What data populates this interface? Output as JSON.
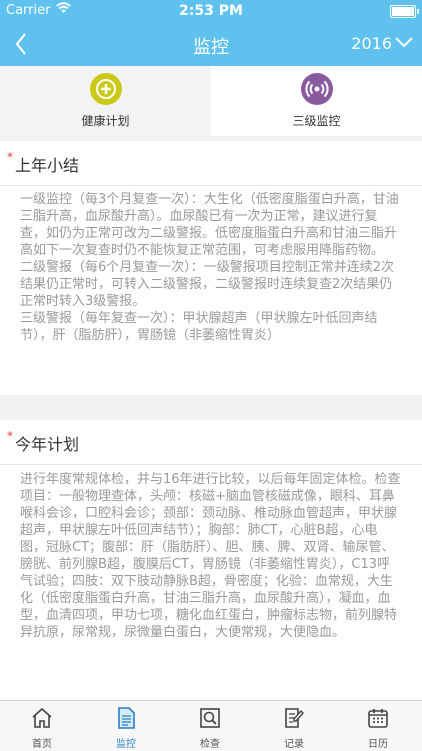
{
  "status": {
    "carrier": "Carrier",
    "time": "2:53 PM",
    "battery_level": 0.9
  },
  "nav": {
    "title": "监控",
    "year": "2016"
  },
  "tabs": [
    {
      "label": "健康计划",
      "color": "#cbc918"
    },
    {
      "label": "三级监控",
      "color": "#8a5a9f"
    }
  ],
  "sections": {
    "last_year": {
      "title": "上年小结",
      "paragraphs": [
        "一级监控（每3个月复查一次）：大生化（低密度脂蛋白升高，甘油三脂升高，血尿酸升高）。血尿酸已有一次为正常，建议进行复查，如仍为正常可改为二级警报。低密度脂蛋白升高和甘油三脂升高如下一次复查时仍不能恢复正常范围，可考虑服用降脂药物。",
        "二级警报（每6个月复查一次）：一级警报项目控制正常并连续2次结果仍正常时，可转入二级警报，二级警报时连续复查2次结果仍正常时转入3级警报。",
        "三级警报（每年复查一次）：甲状腺超声（甲状腺左叶低回声结节），肝（脂肪肝），胃肠镜（非萎缩性胃炎）"
      ]
    },
    "this_year": {
      "title": "今年计划",
      "paragraphs": [
        "进行年度常规体检，并与16年进行比较，以后每年固定体检。检查项目：一般物理查体，头颅：核磁+脑血管核磁成像，眼科、耳鼻喉科会诊，口腔科会诊；颈部：颈动脉、椎动脉血管超声，甲状腺超声，甲状腺左叶低回声结节）；胸部：肺CT，心脏B超，心电图，冠脉CT；腹部：肝（脂肪肝）、胆、胰、脾、双肾、输尿管、膀胱、前列腺B超，腹膜后CT，胃肠镜（非萎缩性胃炎），C13呼气试验；四肢：双下肢动静脉B超，骨密度；化验：血常规，大生化（低密度脂蛋白升高，甘油三脂升高，血尿酸升高），凝血，血型，血清四项，甲功七项，糖化血红蛋白，肿瘤标志物，前列腺特异抗原，尿常规，尿微量白蛋白，大便常规，大便隐血。"
      ]
    }
  },
  "tabbar": [
    {
      "label": "首页",
      "icon": "home-icon"
    },
    {
      "label": "监控",
      "icon": "document-icon",
      "active": true
    },
    {
      "label": "检查",
      "icon": "magnifier-icon"
    },
    {
      "label": "记录",
      "icon": "notepad-pencil-icon"
    },
    {
      "label": "日历",
      "icon": "calendar-icon"
    }
  ],
  "colors": {
    "accent": "#5fc2ee",
    "active_tab": "#2a7fc1",
    "required_star": "#e53935"
  }
}
